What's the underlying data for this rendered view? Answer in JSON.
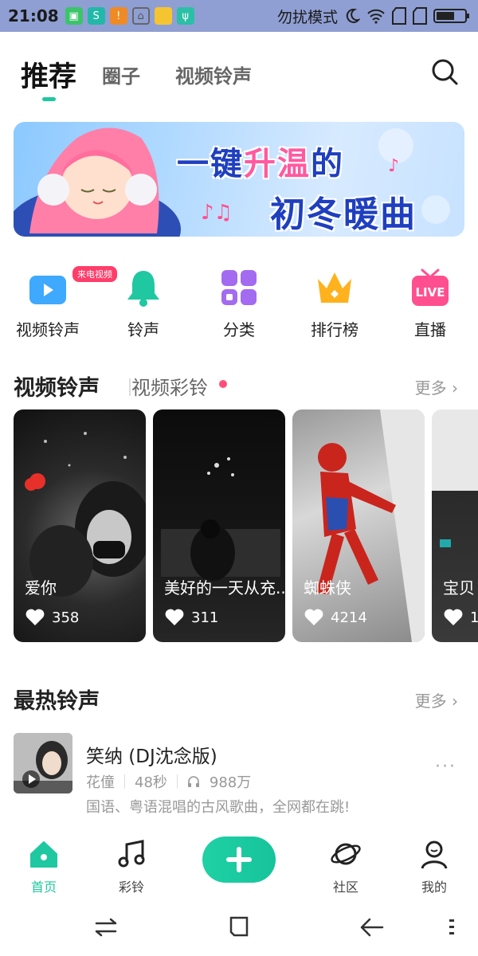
{
  "status_bar": {
    "time": "21:08",
    "dnd_label": "勿扰模式"
  },
  "top_tabs": {
    "active": "推荐",
    "tab2": "圈子",
    "tab3": "视频铃声"
  },
  "banner": {
    "line1_part1": "一键",
    "line1_highlight": "升温",
    "line1_part2": "的",
    "line2": "初冬暖曲"
  },
  "quick_items": [
    {
      "label": "视频铃声",
      "badge": "来电视频",
      "icon": "video-ringtone-icon"
    },
    {
      "label": "铃声",
      "icon": "bell-icon"
    },
    {
      "label": "分类",
      "icon": "grid-icon"
    },
    {
      "label": "排行榜",
      "icon": "crown-icon"
    },
    {
      "label": "直播",
      "icon": "live-tv-icon",
      "icon_text": "LIVE"
    }
  ],
  "video_section": {
    "title": "视频铃声",
    "subtitle": "视频彩铃",
    "more": "更多 ›"
  },
  "video_cards": [
    {
      "title": "爱你",
      "likes": "358"
    },
    {
      "title": "美好的一天从充...",
      "likes": "311"
    },
    {
      "title": "蜘蛛侠",
      "likes": "4214"
    },
    {
      "title": "宝贝",
      "likes": "1"
    }
  ],
  "hot_section": {
    "title": "最热铃声",
    "more": "更多 ›"
  },
  "song": {
    "title": "笑纳 (DJ沈念版)",
    "artist": "花僮",
    "duration": "48秒",
    "plays": "988万",
    "desc": "国语、粤语混唱的古风歌曲，全网都在跳!",
    "more": "···"
  },
  "bottom_nav": {
    "home": "首页",
    "ring": "彩铃",
    "community": "社区",
    "mine": "我的"
  },
  "colors": {
    "accent": "#1fc8a0",
    "status_bar": "#8f9fd3",
    "pink": "#ff4f7a"
  }
}
